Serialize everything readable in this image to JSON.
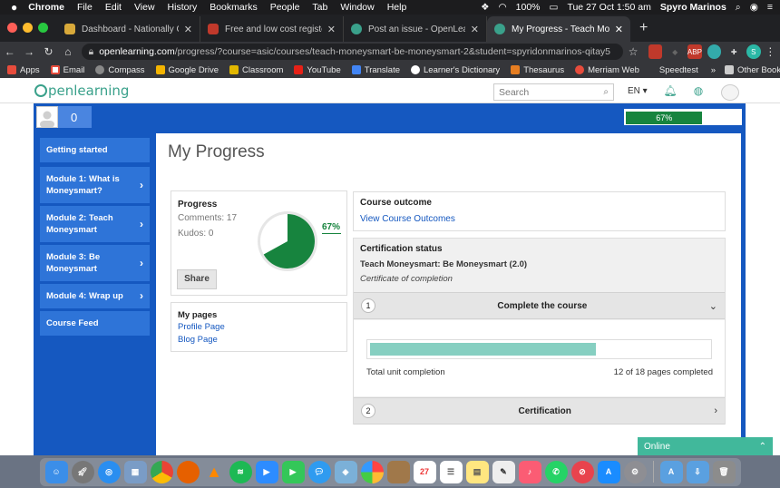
{
  "os_menubar": {
    "apple": "",
    "app": "Chrome",
    "items": [
      "File",
      "Edit",
      "View",
      "History",
      "Bookmarks",
      "People",
      "Tab",
      "Window",
      "Help"
    ],
    "battery": "100%",
    "datetime": "Tue 27 Oct  1:50 am",
    "user": "Spyro Marinos"
  },
  "browser": {
    "tabs": [
      {
        "title": "Dashboard - Nationally Consis",
        "color": "#d8a93a"
      },
      {
        "title": "Free and low cost registered P",
        "color": "#c0392b"
      },
      {
        "title": "Post an issue - OpenLearning F",
        "color": "#3aa18b"
      },
      {
        "title": "My Progress - Teach Moneysm",
        "color": "#3aa18b"
      }
    ],
    "new_tab": "+",
    "url_host": "openlearning.com",
    "url_path": "/progress/?course=asic/courses/teach-moneysmart-be-moneysmart-2&student=spyridonmarinos-qitay5",
    "bookmarks": [
      "Apps",
      "Email",
      "Compass",
      "Google Drive",
      "Classroom",
      "YouTube",
      "Translate",
      "Learner's Dictionary",
      "Thesaurus",
      "Merriam Web",
      "Speedtest"
    ],
    "bookmarks_more": "»",
    "other_bookmarks": "Other Bookmarks"
  },
  "site": {
    "logo_text": "penlearning",
    "search_placeholder": "Search",
    "language": "EN ▾",
    "user_count": "0",
    "overall_progress": "67%"
  },
  "sidebar": {
    "items": [
      {
        "label": "Getting started"
      },
      {
        "label": "Module 1: What is Moneysmart?"
      },
      {
        "label": "Module 2: Teach Moneysmart"
      },
      {
        "label": "Module 3: Be Moneysmart"
      },
      {
        "label": "Module 4: Wrap up"
      },
      {
        "label": "Course Feed"
      }
    ]
  },
  "main": {
    "title": "My Progress",
    "progress": {
      "label": "Progress",
      "comments": "Comments: 17",
      "kudos": "Kudos: 0",
      "percent_label": "67%",
      "percent": 67,
      "share": "Share"
    },
    "my_pages": {
      "label": "My pages",
      "profile": "Profile Page",
      "blog": "Blog Page"
    },
    "course_outcome": {
      "label": "Course outcome",
      "link": "View Course Outcomes"
    },
    "certification": {
      "label": "Certification status",
      "course": "Teach Moneysmart: Be Moneysmart (2.0)",
      "subtitle": "Certificate of completion",
      "step1_num": "1",
      "step1_title": "Complete the course",
      "completion_fraction": 0.667,
      "total_label": "Total unit completion",
      "total_count": "12 of 18 pages completed",
      "step2_num": "2",
      "step2_title": "Certification"
    }
  },
  "chat": {
    "label": "Online"
  },
  "colors": {
    "brand_green": "#3aa18b",
    "brand_blue": "#1558c0",
    "progress_green": "#17843e",
    "bar_teal": "#86cfc1"
  }
}
